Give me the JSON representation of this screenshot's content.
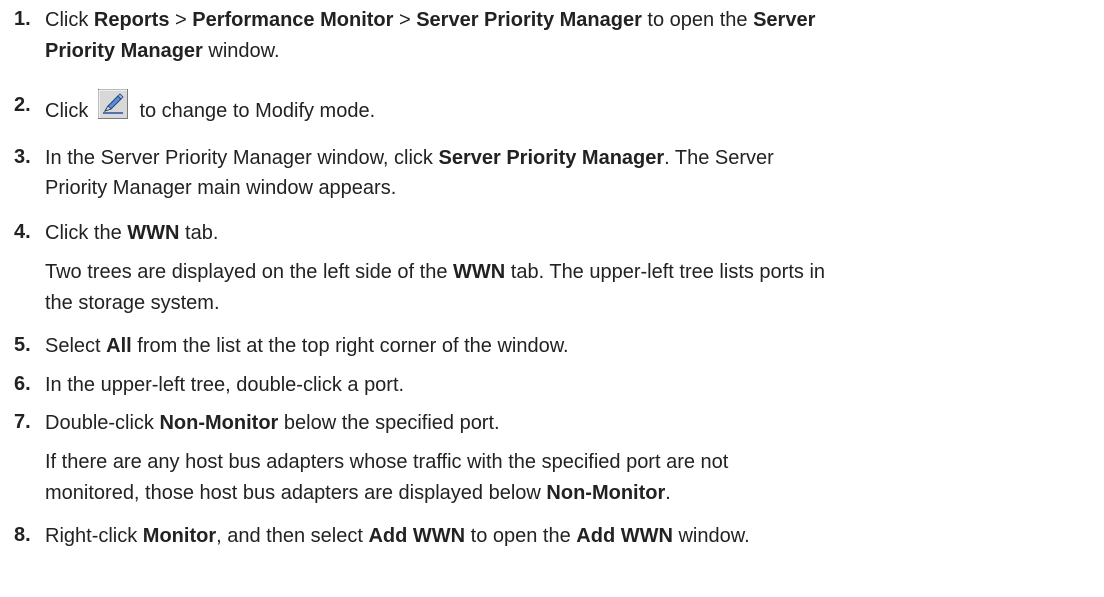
{
  "steps": [
    {
      "number": "1.",
      "parts": {
        "t0": "Click ",
        "b0": "Reports",
        "t1": " > ",
        "b1": "Performance Monitor",
        "t2": " > ",
        "b2": "Server Priority Manager",
        "t3": " to open the ",
        "b3": "Server",
        "b4": "Priority Manager",
        "t4": " window."
      }
    },
    {
      "number": "2.",
      "parts": {
        "t0": "Click ",
        "icon": "modify-mode-pen-icon",
        "t1": " to change to Modify mode."
      }
    },
    {
      "number": "3.",
      "parts": {
        "t0": "In the Server Priority Manager window, click ",
        "b0": "Server Priority Manager",
        "t1": ". The Server",
        "t2": "Priority Manager main window appears."
      }
    },
    {
      "number": "4.",
      "parts": {
        "t0": "Click the ",
        "b0": "WWN",
        "t1": " tab.",
        "p0": "Two trees are displayed on the left side of the ",
        "pb0": "WWN",
        "p1": " tab. The upper-left tree lists ports in",
        "p2": "the storage system."
      }
    },
    {
      "number": "5.",
      "parts": {
        "t0": "Select ",
        "b0": "All",
        "t1": " from the list at the top right corner of the window."
      }
    },
    {
      "number": "6.",
      "parts": {
        "t0": "In the upper-left tree, double-click a port."
      }
    },
    {
      "number": "7.",
      "parts": {
        "t0": "Double-click ",
        "b0": "Non-Monitor",
        "t1": " below the specified port.",
        "p0": "If there are any host bus adapters whose traffic with the specified port are not",
        "p1": "monitored, those host bus adapters are displayed below ",
        "pb0": "Non-Monitor",
        "p2": "."
      }
    },
    {
      "number": "8.",
      "parts": {
        "t0": "Right-click ",
        "b0": "Monitor",
        "t1": ", and then select ",
        "b1": "Add WWN",
        "t2": " to open the ",
        "b2": "Add WWN",
        "t3": " window."
      }
    }
  ]
}
